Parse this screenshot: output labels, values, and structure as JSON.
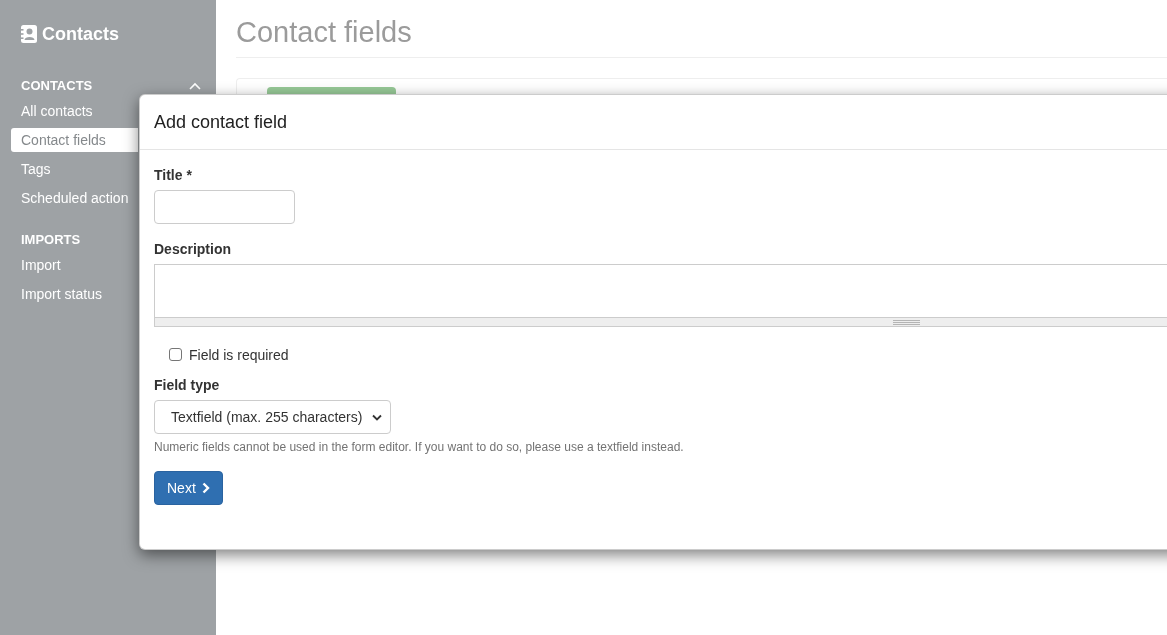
{
  "sidebar": {
    "app_title": "Contacts",
    "sections": [
      {
        "heading": "CONTACTS",
        "expanded": true,
        "items": [
          {
            "label": "All contacts",
            "selected": false
          },
          {
            "label": "Contact fields",
            "selected": true
          },
          {
            "label": "Tags",
            "selected": false
          },
          {
            "label": "Scheduled action",
            "selected": false
          }
        ]
      },
      {
        "heading": "IMPORTS",
        "items": [
          {
            "label": "Import",
            "selected": false
          },
          {
            "label": "Import status",
            "selected": false
          }
        ]
      }
    ]
  },
  "page": {
    "title": "Contact fields"
  },
  "dialog": {
    "title": "Add contact field",
    "fields": [
      {
        "kind": "text",
        "label": "Title *"
      },
      {
        "kind": "textarea",
        "label": "Description"
      },
      {
        "kind": "checkbox",
        "label": "Field is required",
        "checked": false
      },
      {
        "kind": "select",
        "label": "Field type",
        "value": "Textfield (max. 255 characters)",
        "help": "Numeric fields cannot be used in the form editor. If you want to do so, please use a textfield instead."
      }
    ],
    "buttons": [
      {
        "label": "Next"
      }
    ]
  }
}
